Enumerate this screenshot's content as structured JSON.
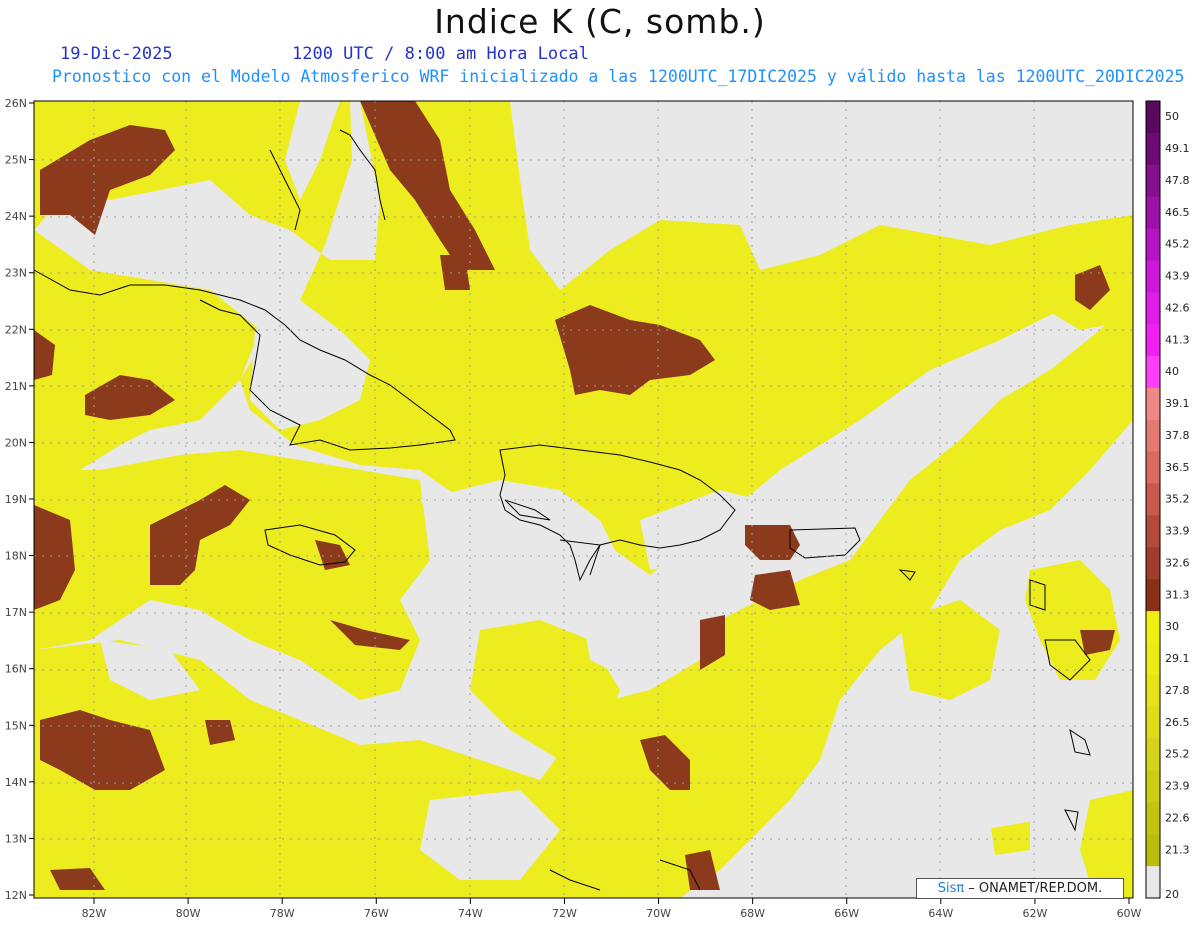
{
  "title": "Indice K (C, somb.)",
  "date": "19-Dic-2025",
  "time": "1200 UTC / 8:00 am Hora Local",
  "subtitle": "Pronostico con el Modelo Atmosferico WRF inicializado a las 1200UTC_17DIC2025 y válido hasta las  1200UTC_20DIC2025",
  "credit": {
    "brand": "Sisπ",
    "text": "– ONAMET/REP.DOM."
  },
  "lat_labels": [
    "26N",
    "25N",
    "24N",
    "23N",
    "22N",
    "21N",
    "20N",
    "19N",
    "18N",
    "17N",
    "16N",
    "15N",
    "14N",
    "13N",
    "12N"
  ],
  "lon_labels": [
    "82W",
    "80W",
    "78W",
    "76W",
    "74W",
    "72W",
    "70W",
    "68W",
    "66W",
    "64W",
    "62W",
    "60W"
  ],
  "colorbar": {
    "labels": [
      "50",
      "49.1",
      "47.8",
      "46.5",
      "45.2",
      "43.9",
      "42.6",
      "41.3",
      "40",
      "39.1",
      "37.8",
      "36.5",
      "35.2",
      "33.9",
      "32.6",
      "31.3",
      "30",
      "29.1",
      "27.8",
      "26.5",
      "25.2",
      "23.9",
      "22.6",
      "21.3",
      "20"
    ],
    "colors": [
      "#5a0a5e",
      "#6e0a76",
      "#84108e",
      "#9a10a8",
      "#b414c2",
      "#cc18d8",
      "#e01ce8",
      "#f020f0",
      "#ff3ef8",
      "#f08888",
      "#e47a72",
      "#d86a60",
      "#c85a4c",
      "#b44a3a",
      "#a03c2c",
      "#8a3018",
      "#f0f010",
      "#eaec14",
      "#e4e418",
      "#dcdc18",
      "#d4d418",
      "#cccc14",
      "#c4c410",
      "#bcbc0c"
    ],
    "no_data_color": "#e8e8e8"
  },
  "colors": {
    "yellow": "#ecec1e",
    "darkyellow": "#d8d818",
    "brown": "#8c3a1c",
    "brown_light": "#a04a2e",
    "nodata": "#e8e8e8",
    "coast": "#000000",
    "grid": "#a0a0a0"
  }
}
